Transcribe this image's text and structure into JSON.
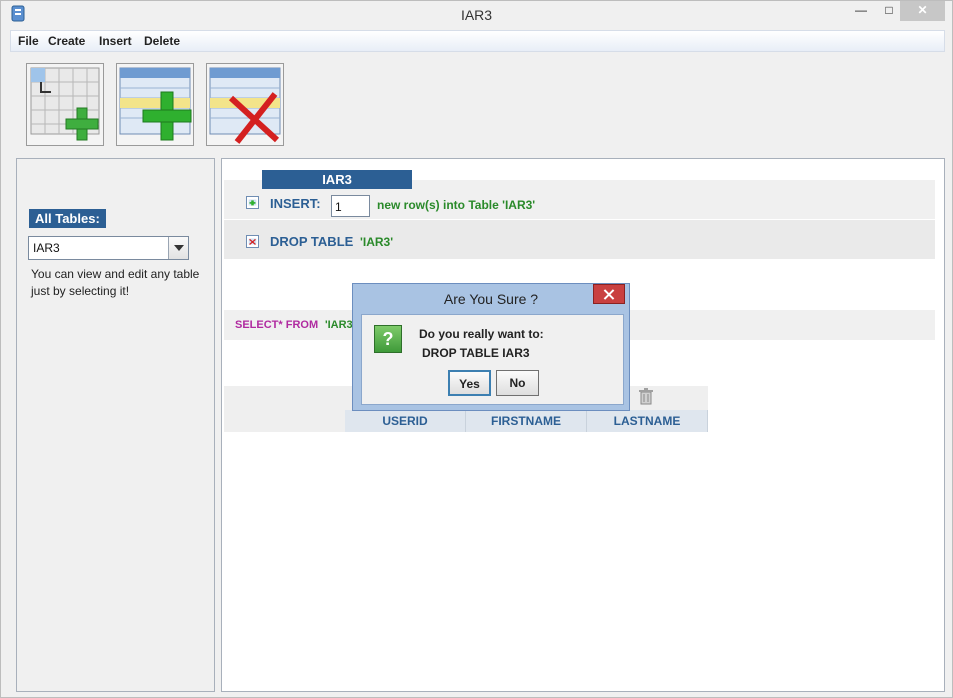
{
  "window": {
    "title": "IAR3",
    "minimize_glyph": "—",
    "maximize_glyph": "□",
    "close_glyph": "✕"
  },
  "menu": {
    "items": [
      "File",
      "Create",
      "Insert",
      "Delete"
    ]
  },
  "toolbar": {
    "buttons": [
      {
        "icon": "new-table-icon"
      },
      {
        "icon": "add-rows-icon"
      },
      {
        "icon": "delete-table-icon"
      }
    ]
  },
  "sidebar": {
    "all_tables_label": "All Tables:",
    "selected_table": "IAR3",
    "hint": "You can view and edit any table just by selecting it!"
  },
  "main": {
    "tab_label": "IAR3",
    "insert": {
      "label": "INSERT:",
      "value": "1",
      "suffix": "new row(s) into Table 'IAR3'"
    },
    "drop": {
      "label": "DROP TABLE",
      "table": "'IAR3'"
    },
    "select": {
      "keyword": "SELECT* FROM",
      "table": "'IAR3"
    },
    "grid": {
      "columns": [
        "USERID",
        "FIRSTNAME",
        "LASTNAME"
      ]
    }
  },
  "dialog": {
    "title": "Are You Sure ?",
    "icon_glyph": "?",
    "message_line1": "Do you really want to:",
    "message_line2": "DROP TABLE IAR3",
    "yes_label": "Yes",
    "no_label": "No"
  },
  "colors": {
    "accent": "#2c5f94",
    "green": "#2a8a2a",
    "magenta": "#b02aa0",
    "dialog_frame": "#a9c3e3"
  }
}
